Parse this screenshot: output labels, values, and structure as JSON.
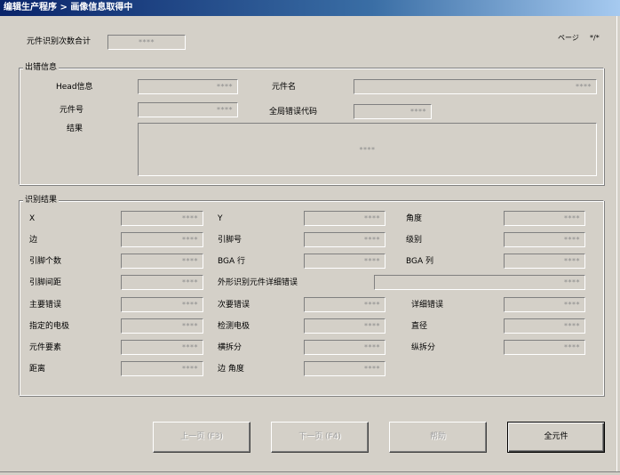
{
  "window": {
    "title": "编辑生产程序 > 画像信息取得中"
  },
  "header": {
    "count_label": "元件识别次数合计",
    "count_value": "****",
    "page_label": "ページ",
    "page_value": "*/*"
  },
  "output_info": {
    "title": "出错信息",
    "head_label": "Head信息",
    "head_value": "****",
    "part_name_label": "元件名",
    "part_name_value": "****",
    "part_no_label": "元件号",
    "part_no_value": "****",
    "global_error_label": "全局错误代码",
    "global_error_value": "****",
    "result_label": "结果",
    "result_value": "****"
  },
  "recognition": {
    "title": "识别结果",
    "x_label": "X",
    "x_value": "****",
    "y_label": "Y",
    "y_value": "****",
    "angle_label": "角度",
    "angle_value": "****",
    "side_label": "边",
    "side_value": "****",
    "pin_no_label": "引脚号",
    "pin_no_value": "****",
    "level_label": "级别",
    "level_value": "****",
    "pin_count_label": "引脚个数",
    "pin_count_value": "****",
    "bga_row_label": "BGA 行",
    "bga_row_value": "****",
    "bga_col_label": "BGA 列",
    "bga_col_value": "****",
    "pin_pitch_label": "引脚间距",
    "pin_pitch_value": "****",
    "shape_error_label": "外形识别元件详细错误",
    "shape_error_value": "****",
    "main_error_label": "主要错误",
    "main_error_value": "****",
    "sub_error_label": "次要错误",
    "sub_error_value": "****",
    "detail_error_label": "详细错误",
    "detail_error_value": "****",
    "spec_electrode_label": "指定的电极",
    "spec_electrode_value": "****",
    "detect_electrode_label": "检测电极",
    "detect_electrode_value": "****",
    "diameter_label": "直径",
    "diameter_value": "****",
    "part_element_label": "元件要素",
    "part_element_value": "****",
    "h_split_label": "横拆分",
    "h_split_value": "****",
    "v_split_label": "纵拆分",
    "v_split_value": "****",
    "distance_label": "距离",
    "distance_value": "****",
    "side_angle_label": "边 角度",
    "side_angle_value": "****"
  },
  "buttons": {
    "prev": "上一页 (F3)",
    "next": "下一页 (F4)",
    "help": "帮助",
    "all_parts": "全元件"
  }
}
